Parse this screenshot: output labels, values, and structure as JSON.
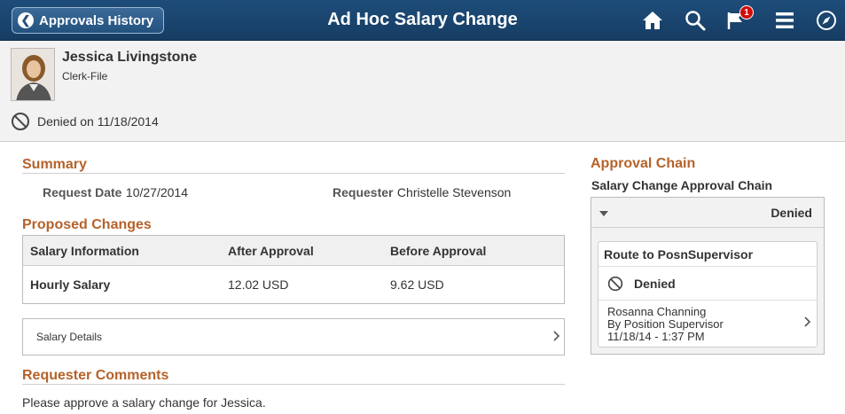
{
  "header": {
    "back_label": "Approvals History",
    "title": "Ad Hoc Salary Change",
    "notification_count": "1",
    "icons": [
      "home-icon",
      "search-icon",
      "notification-flag-icon",
      "menu-icon",
      "navbar-compass-icon"
    ]
  },
  "employee": {
    "name": "Jessica Livingstone",
    "job": "Clerk-File",
    "status_text": "Denied on 11/18/2014"
  },
  "summary": {
    "title": "Summary",
    "request_date_label": "Request Date",
    "request_date": "10/27/2014",
    "requester_label": "Requester",
    "requester": "Christelle Stevenson"
  },
  "proposed": {
    "title": "Proposed Changes",
    "columns": [
      "Salary Information",
      "After Approval",
      "Before Approval"
    ],
    "rows": [
      {
        "info": "Hourly Salary",
        "after": "12.02 USD",
        "before": "9.62 USD"
      }
    ],
    "details_label": "Salary Details"
  },
  "comments": {
    "title": "Requester Comments",
    "text": "Please approve a salary change for Jessica."
  },
  "approval": {
    "title": "Approval Chain",
    "chain_name": "Salary Change Approval Chain",
    "chain_status": "Denied",
    "step_title": "Route to PosnSupervisor",
    "step_status": "Denied",
    "approver_name": "Rosanna Channing",
    "approver_role": "By Position Supervisor",
    "approver_time": "11/18/14 - 1:37 PM"
  },
  "colors": {
    "header_bg": "#1e4d7a",
    "section_title": "#b5622a",
    "badge": "#d10b0b"
  }
}
